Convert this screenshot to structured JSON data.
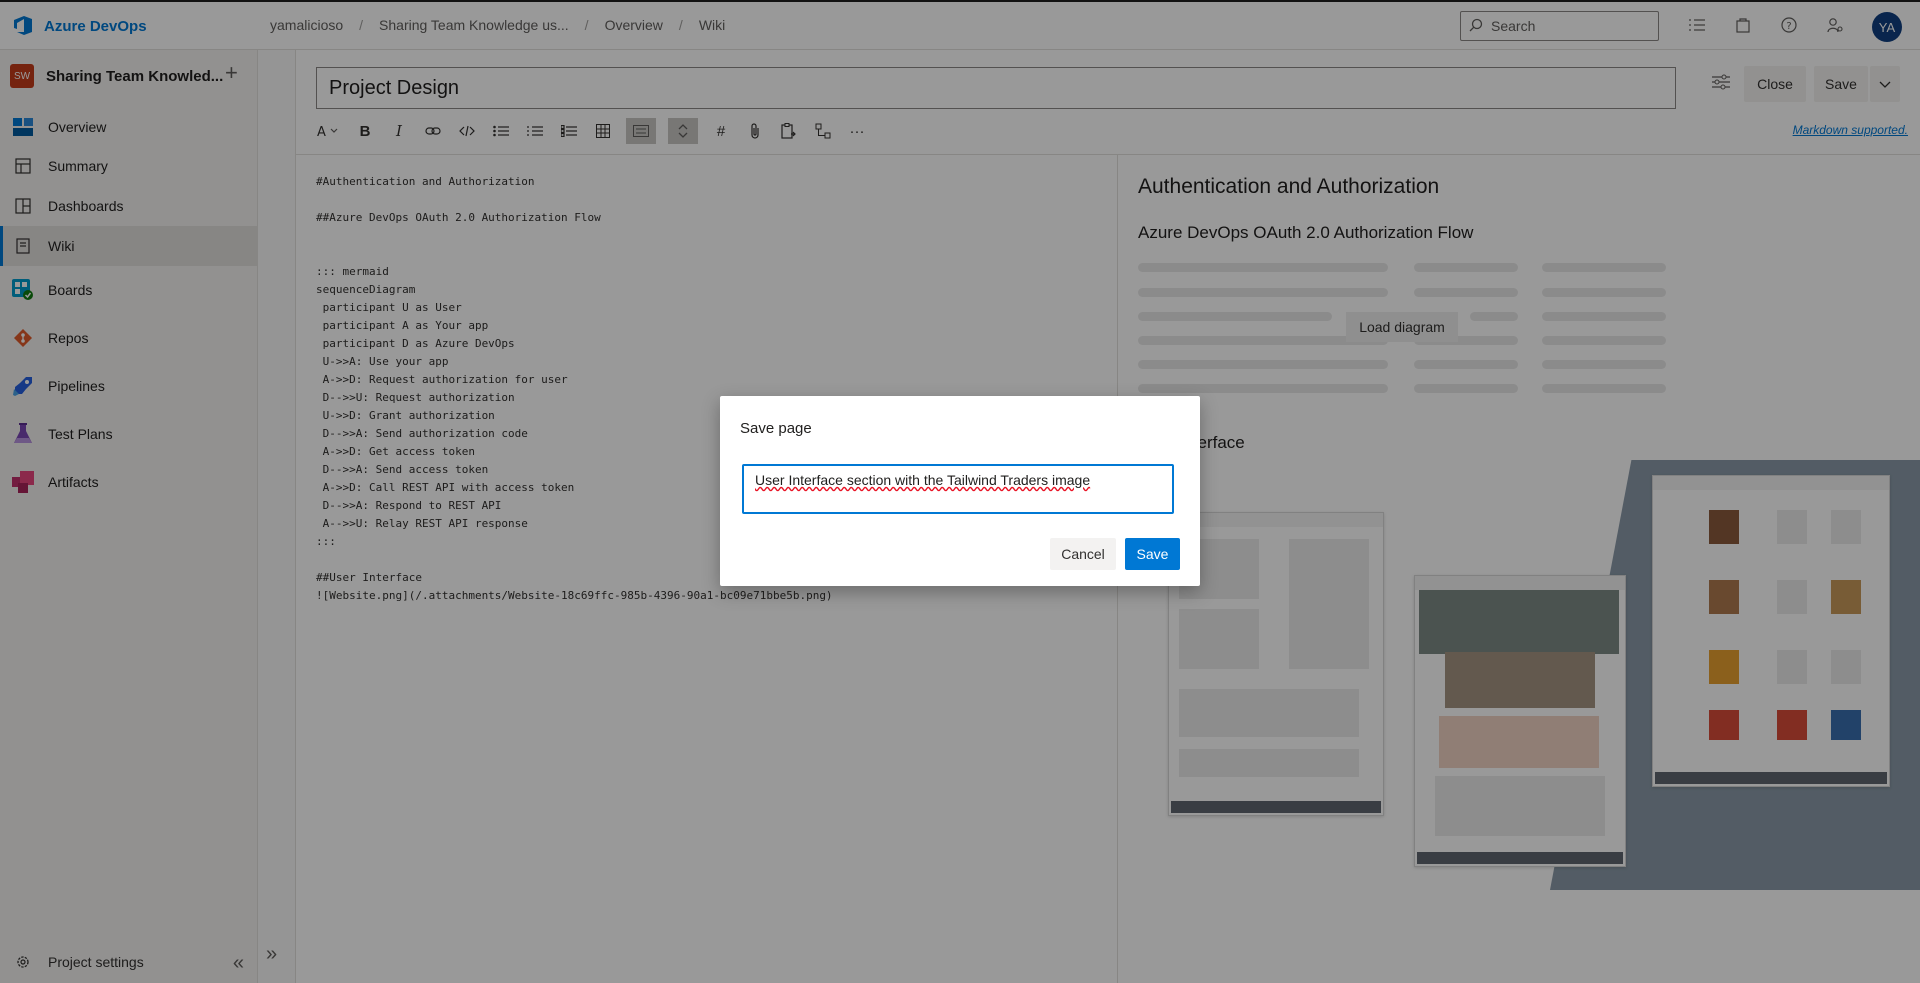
{
  "app": {
    "name": "Azure DevOps"
  },
  "breadcrumb": [
    "yamalicioso",
    "Sharing Team Knowledge us...",
    "Overview",
    "Wiki"
  ],
  "search": {
    "placeholder": "Search"
  },
  "user": {
    "initials": "YA"
  },
  "project": {
    "badge": "SW",
    "name": "Sharing Team Knowled..."
  },
  "sidebar": {
    "items": [
      {
        "label": "Overview",
        "icon": "overview-icon"
      },
      {
        "label": "Summary",
        "icon": "summary-icon"
      },
      {
        "label": "Dashboards",
        "icon": "dashboards-icon"
      },
      {
        "label": "Wiki",
        "icon": "wiki-icon",
        "selected": true
      },
      {
        "label": "Boards",
        "icon": "boards-icon"
      },
      {
        "label": "Repos",
        "icon": "repos-icon"
      },
      {
        "label": "Pipelines",
        "icon": "pipelines-icon"
      },
      {
        "label": "Test Plans",
        "icon": "test-plans-icon"
      },
      {
        "label": "Artifacts",
        "icon": "artifacts-icon"
      }
    ],
    "footer": "Project settings"
  },
  "editor": {
    "title": "Project Design",
    "close_label": "Close",
    "save_label": "Save",
    "markdown_link": "Markdown supported.",
    "source": "#Authentication and Authorization\n\n##Azure DevOps OAuth 2.0 Authorization Flow\n\n\n::: mermaid\nsequenceDiagram\n participant U as User\n participant A as Your app\n participant D as Azure DevOps\n U->>A: Use your app\n A->>D: Request authorization for user\n D-->>U: Request authorization\n U->>D: Grant authorization\n D-->>A: Send authorization code\n A->>D: Get access token\n D-->>A: Send access token\n A->>D: Call REST API with access token\n D-->>A: Respond to REST API\n A-->>U: Relay REST API response\n:::\n\n##User Interface\n![Website.png](/.attachments/Website-18c69ffc-985b-4396-90a1-bc09e71bbe5b.png)"
  },
  "preview": {
    "h1": "Authentication and Authorization",
    "h2": "Azure DevOps OAuth 2.0 Authorization Flow",
    "load_diagram": "Load diagram",
    "h3": "User Interface"
  },
  "dialog": {
    "title": "Save page",
    "comment_value": "User Interface section with the Tailwind Traders image",
    "cancel_label": "Cancel",
    "save_label": "Save"
  },
  "colors": {
    "accent": "#0078d4",
    "project_badge": "#c43b1a",
    "avatar": "#0f3f80"
  }
}
